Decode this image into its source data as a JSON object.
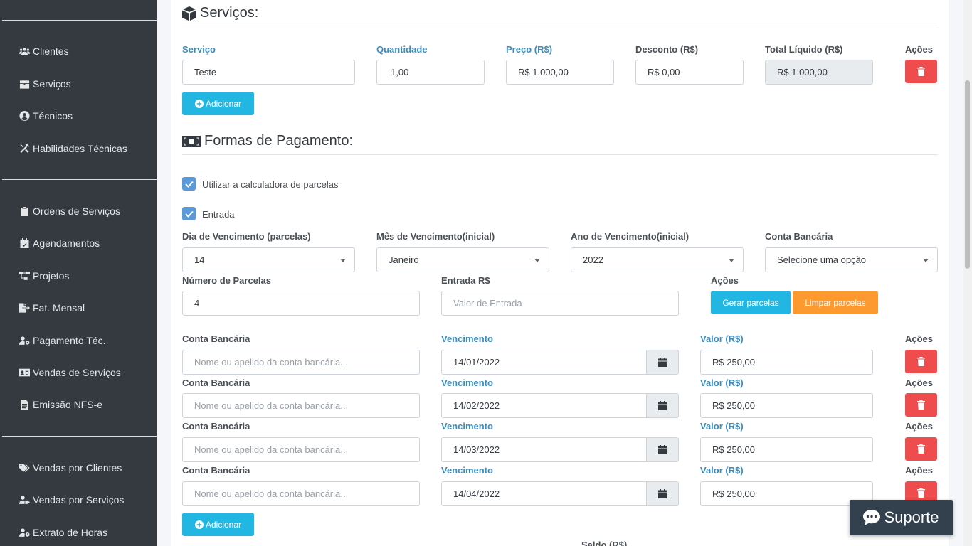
{
  "sidebar": {
    "items": [
      {
        "label": "Clientes",
        "icon": "users-icon"
      },
      {
        "label": "Serviços",
        "icon": "briefcase-icon"
      },
      {
        "label": "Técnicos",
        "icon": "user-circle-icon"
      },
      {
        "label": "Habilidades Técnicas",
        "icon": "tools-icon"
      },
      {
        "label": "Ordens de Serviços",
        "icon": "clipboard-icon"
      },
      {
        "label": "Agendamentos",
        "icon": "calendar-check-icon"
      },
      {
        "label": "Projetos",
        "icon": "project-diagram-icon"
      },
      {
        "label": "Fat. Mensal",
        "icon": "file-export-icon"
      },
      {
        "label": "Pagamento Téc.",
        "icon": "user-cog-icon"
      },
      {
        "label": "Vendas de Serviços",
        "icon": "id-card-icon"
      },
      {
        "label": "Emissão NFS-e",
        "icon": "file-invoice-icon"
      },
      {
        "label": "Vendas por Clientes",
        "icon": "tags-icon"
      },
      {
        "label": "Vendas por Serviços",
        "icon": "user-tag-icon"
      },
      {
        "label": "Extrato de Horas",
        "icon": "user-clock-icon"
      }
    ]
  },
  "services": {
    "title": "Serviços:",
    "labels": {
      "servico": "Serviço",
      "quantidade": "Quantidade",
      "preco": "Preço (R$)",
      "desconto": "Desconto (R$)",
      "total": "Total Líquido (R$)",
      "acoes": "Ações"
    },
    "row": {
      "servico": "Teste",
      "quantidade": "1,00",
      "preco": "R$ 1.000,00",
      "desconto": "R$ 0,00",
      "total": "R$ 1.000,00"
    },
    "add_label": "Adicionar"
  },
  "payment": {
    "title": "Formas de Pagamento:",
    "use_calculator_label": "Utilizar a calculadora de parcelas",
    "entrada_label": "Entrada",
    "labels": {
      "dia": "Dia de Vencimento (parcelas)",
      "mes": "Mês de Vencimento(inicial)",
      "ano": "Ano de Vencimento(inicial)",
      "conta": "Conta Bancária",
      "num_parcelas": "Número de Parcelas",
      "entrada_rs": "Entrada R$",
      "acoes": "Ações",
      "vencimento": "Vencimento",
      "valor": "Valor (R$)",
      "saldo": "Saldo (R$)"
    },
    "dia": "14",
    "mes": "Janeiro",
    "ano": "2022",
    "conta": "Selecione uma opção",
    "num_parcelas": "4",
    "entrada_placeholder": "Valor de Entrada",
    "gerar_label": "Gerar parcelas",
    "limpar_label": "Limpar parcelas",
    "conta_placeholder": "Nome ou apelido da conta bancária...",
    "installments": [
      {
        "vencimento": "14/01/2022",
        "valor": "R$ 250,00"
      },
      {
        "vencimento": "14/02/2022",
        "valor": "R$ 250,00"
      },
      {
        "vencimento": "14/03/2022",
        "valor": "R$ 250,00"
      },
      {
        "vencimento": "14/04/2022",
        "valor": "R$ 250,00"
      }
    ],
    "add_label": "Adicionar"
  },
  "support": {
    "label": "Suporte"
  },
  "colors": {
    "sidebar_bg": "#343a40",
    "info": "#22b7e3",
    "warning": "#fd9a2f",
    "danger": "#ef4d4d",
    "label_blue": "#3c8dbc",
    "checkbox": "#5b9ad8"
  }
}
